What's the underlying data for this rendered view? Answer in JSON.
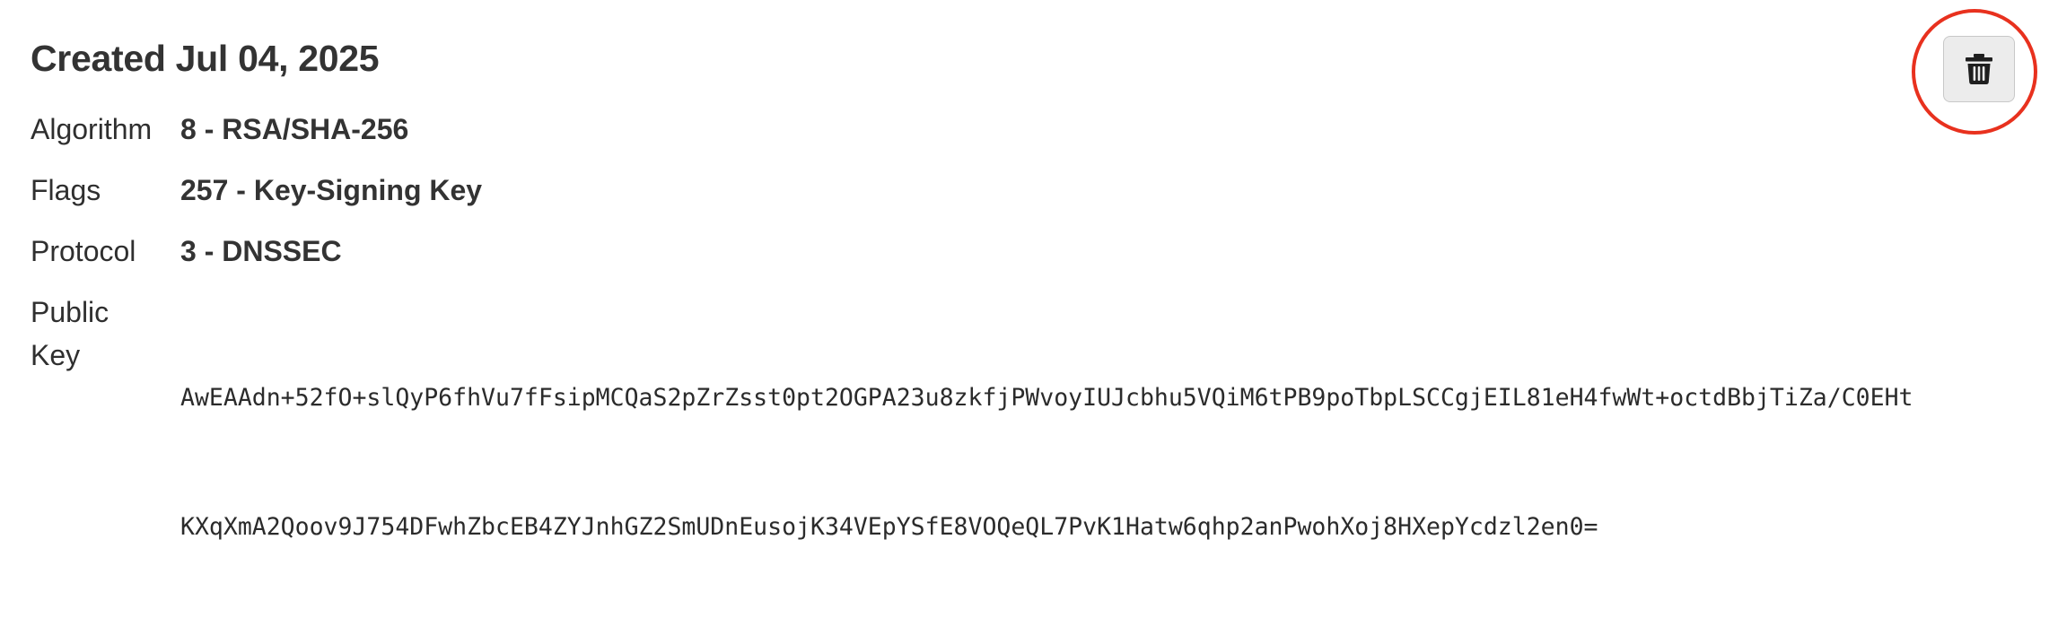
{
  "key": {
    "title": "Created Jul 04, 2025",
    "algorithm": {
      "label": "Algorithm",
      "value": "8 - RSA/SHA-256"
    },
    "flags": {
      "label": "Flags",
      "value": "257 - Key-Signing Key"
    },
    "protocol": {
      "label": "Protocol",
      "value": "3 - DNSSEC"
    },
    "public_key": {
      "label_line1": "Public",
      "label_line2": "Key",
      "line1": "AwEAAdn+52fO+slQyP6fhVu7fFsipMCQaS2pZrZsst0pt2OGPA23u8zkfjPWvoyIUJcbhu5VQiM6tPB9poTbpLSCCgjEIL81eH4fwWt+octdBbjTiZa/C0EHt",
      "line2": "KXqXmA2Qoov9J754DFwhZbcEB4ZYJnhGZ2SmUDnEusojK34VEpYSfE8VOQeQL7PvK1Hatw6qhp2anPwohXoj8HXepYcdzl2en0="
    }
  },
  "actions": {
    "delete_icon": "trash-icon",
    "highlight_color": "#e8311e"
  }
}
